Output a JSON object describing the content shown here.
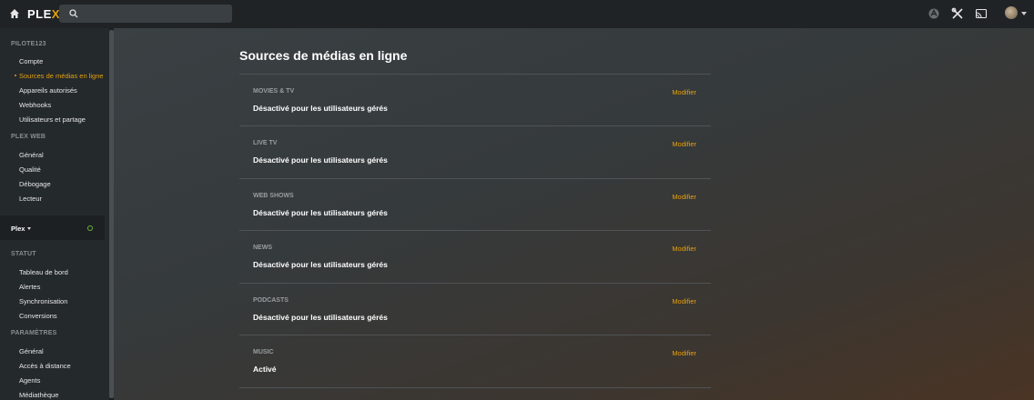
{
  "topbar": {
    "logo_plex": "PLE",
    "logo_x": "X",
    "search_placeholder": "",
    "icons": [
      "home-icon",
      "search-icon",
      "activity-icon",
      "settings-tools-icon",
      "cast-icon",
      "avatar"
    ]
  },
  "sidebar": {
    "account_header": "PILOTE123",
    "account_items": [
      {
        "label": "Compte"
      },
      {
        "label": "Sources de médias en ligne",
        "active": true
      },
      {
        "label": "Appareils autorisés"
      },
      {
        "label": "Webhooks"
      },
      {
        "label": "Utilisateurs et partage"
      }
    ],
    "web_header": "PLEX WEB",
    "web_items": [
      {
        "label": "Général"
      },
      {
        "label": "Qualité"
      },
      {
        "label": "Débogage"
      },
      {
        "label": "Lecteur"
      }
    ],
    "server": {
      "name": "Plex"
    },
    "status_header": "STATUT",
    "status_items": [
      {
        "label": "Tableau de bord"
      },
      {
        "label": "Alertes"
      },
      {
        "label": "Synchronisation"
      },
      {
        "label": "Conversions"
      }
    ],
    "settings_header": "PARAMÈTRES",
    "settings_items": [
      {
        "label": "Général"
      },
      {
        "label": "Accès à distance"
      },
      {
        "label": "Agents"
      },
      {
        "label": "Médiathèque"
      }
    ]
  },
  "main": {
    "title": "Sources de médias en ligne",
    "sections": [
      {
        "category": "MOVIES & TV",
        "status": "Désactivé pour les utilisateurs gérés",
        "edit": "Modifier"
      },
      {
        "category": "LIVE TV",
        "status": "Désactivé pour les utilisateurs gérés",
        "edit": "Modifier"
      },
      {
        "category": "WEB SHOWS",
        "status": "Désactivé pour les utilisateurs gérés",
        "edit": "Modifier"
      },
      {
        "category": "NEWS",
        "status": "Désactivé pour les utilisateurs gérés",
        "edit": "Modifier"
      },
      {
        "category": "PODCASTS",
        "status": "Désactivé pour les utilisateurs gérés",
        "edit": "Modifier"
      },
      {
        "category": "MUSIC",
        "status": "Activé",
        "edit": "Modifier"
      }
    ]
  },
  "colors": {
    "accent": "#e5a00d",
    "server_status": "#6bb33a"
  }
}
